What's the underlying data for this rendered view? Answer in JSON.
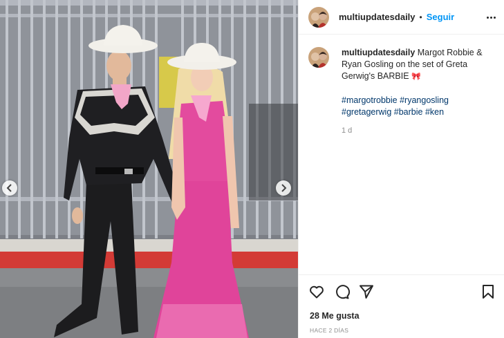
{
  "post": {
    "username": "multiupdatesdaily",
    "separator": "•",
    "follow_label": "Seguir",
    "more_icon": "more-options-icon",
    "caption": {
      "username": "multiupdatesdaily",
      "text": "Margot Robbie & Ryan Gosling on the set of Greta Gerwig's BARBIE",
      "emoji": "🎀",
      "hashtags": [
        "#margotrobbie",
        "#ryangosling",
        "#gretagerwig",
        "#barbie",
        "#ken"
      ],
      "time": "1 d"
    },
    "media": {
      "prev_icon": "chevron-left-icon",
      "next_icon": "chevron-right-icon",
      "colors": {
        "pink_outfit": "#e0449a",
        "black_outfit": "#1c1c1e",
        "hat": "#f2f0ea",
        "fence": "#a9adb5",
        "curb": "#d33b36"
      }
    },
    "actions": {
      "like_icon": "heart-icon",
      "comment_icon": "comment-icon",
      "share_icon": "send-icon",
      "save_icon": "bookmark-icon"
    },
    "likes_text": "28 Me gusta",
    "date_text": "HACE 2 DÍAS",
    "accent_color": "#0095f6"
  }
}
